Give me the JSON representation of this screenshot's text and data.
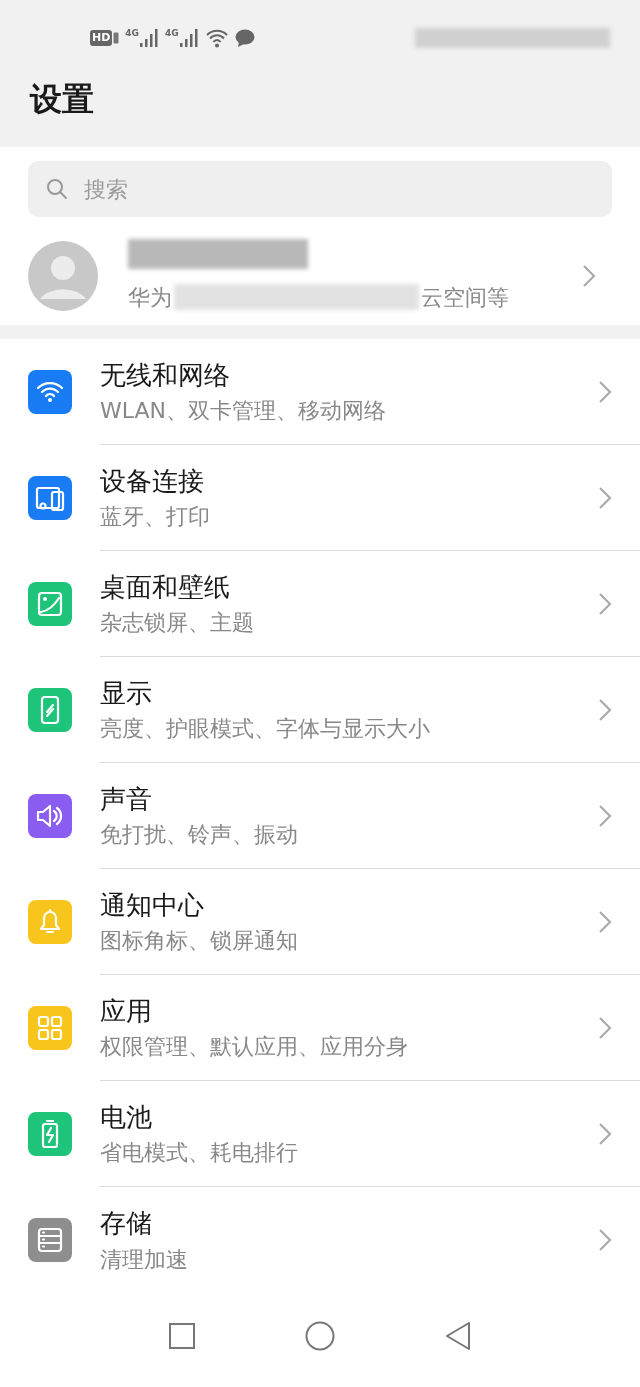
{
  "status_bar": {
    "indicators": [
      {
        "kind": "hd",
        "label": "HD"
      },
      {
        "kind": "signal",
        "label": "4G"
      },
      {
        "kind": "signal",
        "label": "4G"
      },
      {
        "kind": "wifi"
      },
      {
        "kind": "message"
      }
    ]
  },
  "title": "设置",
  "search": {
    "placeholder": "搜索"
  },
  "account": {
    "subtitle_start": "华为",
    "subtitle_end": "云空间等"
  },
  "items": [
    {
      "kind": "wifi",
      "color": "#1a7cf5",
      "title": "无线和网络",
      "subtitle": "WLAN、双卡管理、移动网络"
    },
    {
      "kind": "devices",
      "color": "#1a7cf5",
      "title": "设备连接",
      "subtitle": "蓝牙、打印"
    },
    {
      "kind": "wallpaper",
      "color": "#1ec47a",
      "title": "桌面和壁纸",
      "subtitle": "杂志锁屏、主题"
    },
    {
      "kind": "display",
      "color": "#1ec47a",
      "title": "显示",
      "subtitle": "亮度、护眼模式、字体与显示大小"
    },
    {
      "kind": "sound",
      "color": "#8a5cf0",
      "title": "声音",
      "subtitle": "免打扰、铃声、振动"
    },
    {
      "kind": "bell",
      "color": "#f8c51c",
      "title": "通知中心",
      "subtitle": "图标角标、锁屏通知"
    },
    {
      "kind": "apps",
      "color": "#f8c51c",
      "title": "应用",
      "subtitle": "权限管理、默认应用、应用分身"
    },
    {
      "kind": "battery",
      "color": "#1ec47a",
      "title": "电池",
      "subtitle": "省电模式、耗电排行"
    },
    {
      "kind": "storage",
      "color": "#8e8e8e",
      "title": "存储",
      "subtitle": "清理加速"
    }
  ]
}
